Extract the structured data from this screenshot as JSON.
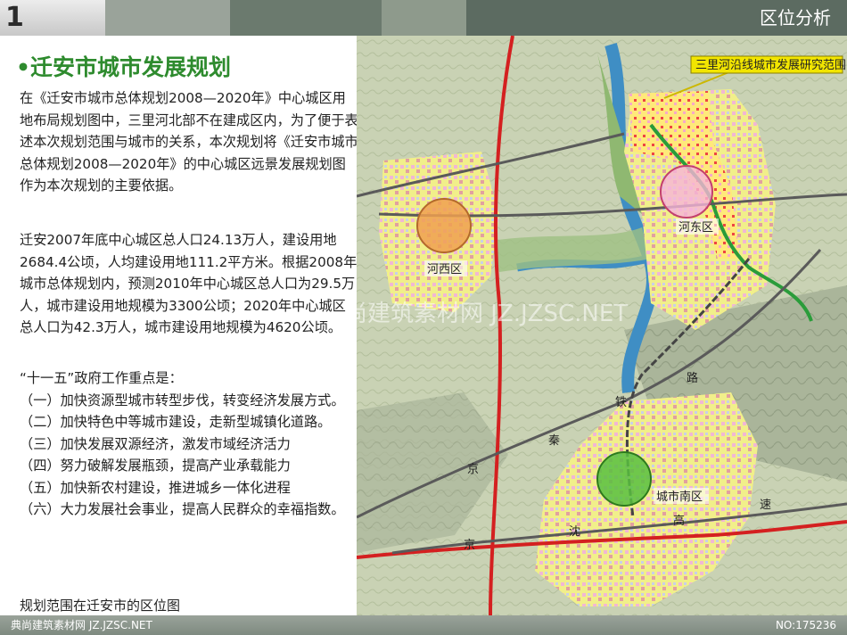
{
  "header": {
    "slide_number": "1",
    "section_title": "区位分析"
  },
  "main": {
    "title": "•迁安市城市发展规划",
    "paragraphs": [
      "在《迁安市城市总体规划2008—2020年》中心城区用地布局规划图中，三里河北部不在建成区内，为了便于表述本次规划范围与城市的关系，本次规划将《迁安市城市总体规划2008—2020年》的中心城区远景发展规划图作为本次规划的主要依据。",
      "迁安2007年底中心城区总人口24.13万人，建设用地2684.4公顷，人均建设用地111.2平方米。根据2008年城市总体规划内，预测2010年中心城区总人口为29.5万人，城市建设用地规模为3300公顷；2020年中心城区总人口为42.3万人，城市建设用地规模为4620公顷。"
    ],
    "priorities_heading": "“十一五”政府工作重点是：",
    "priorities": [
      "（一）加快资源型城市转型步伐，转变经济发展方式。",
      "（二）加快特色中等城市建设，走新型城镇化道路。",
      "（三）加快发展双源经济，激发市域经济活力",
      "（四）努力破解发展瓶颈，提高产业承载能力",
      "（五）加快新农村建设，推进城乡一体化进程",
      "（六）大力发展社会事业，提高人民群众的幸福指数。"
    ],
    "caption": "规划范围在迁安市的区位图"
  },
  "map": {
    "callout": "三里河沿线城市发展研究范围",
    "districts": [
      "河西区",
      "河东区",
      "城市南区"
    ],
    "rail_labels": [
      "铁",
      "路"
    ],
    "highway_labels": [
      "京",
      "秦",
      "京",
      "沈",
      "高",
      "速"
    ],
    "watermark": "典尚建筑素材网 JZ.JZSC.NET",
    "colors": {
      "river": "#3f8ec4",
      "red_road": "#d42020",
      "callout_fill": "#f2e500",
      "hexi_circle": "#f0a050",
      "hedong_circle": "#f6b4d8",
      "nan_circle": "#58c040"
    }
  },
  "footer": {
    "watermark": "典尚建筑素材网 JZ.JZSC.NET",
    "number": "NO:175236"
  }
}
